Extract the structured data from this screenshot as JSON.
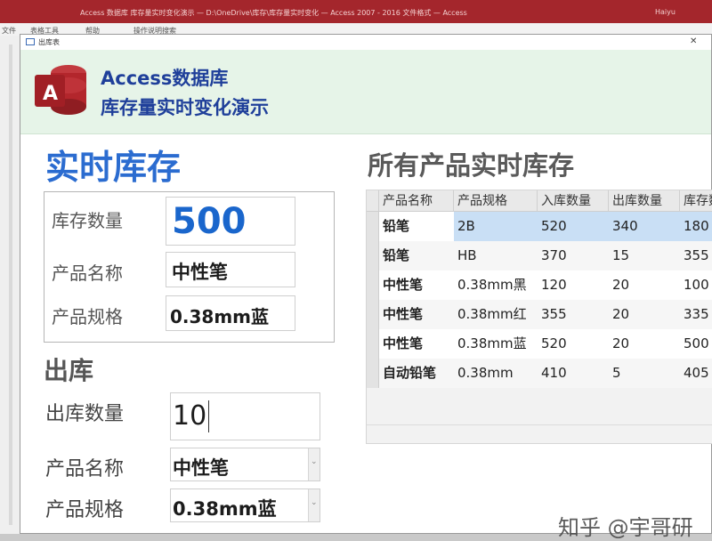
{
  "app": {
    "titlebar_text": "Access 数据库 库存量实时变化演示 — D:\\OneDrive\\库存\\库存量实时变化 — Access 2007 - 2016 文件格式 — Access",
    "user_text": "Haiyu"
  },
  "ribbon": {
    "items": [
      "文件",
      "表格工具",
      "帮助",
      "操作说明搜索"
    ]
  },
  "form": {
    "tab_label": "出库表",
    "header": {
      "line1": "Access数据库",
      "line2": "库存量实时变化演示",
      "logo_letter": "A"
    },
    "stock": {
      "title": "实时库存",
      "qty_label": "库存数量",
      "qty_value": "500",
      "name_label": "产品名称",
      "name_value": "中性笔",
      "spec_label": "产品规格",
      "spec_value": "0.38mm蓝"
    },
    "outbound": {
      "title": "出库",
      "qty_label": "出库数量",
      "qty_value": "10",
      "name_label": "产品名称",
      "name_value": "中性笔",
      "spec_label": "产品规格",
      "spec_value": "0.38mm蓝"
    },
    "all_products": {
      "title": "所有产品实时库存",
      "columns": [
        "产品名称",
        "产品规格",
        "入库数量",
        "出库数量",
        "库存数量"
      ],
      "rows": [
        [
          "铅笔",
          "2B",
          "520",
          "340",
          "180"
        ],
        [
          "铅笔",
          "HB",
          "370",
          "15",
          "355"
        ],
        [
          "中性笔",
          "0.38mm黑",
          "120",
          "20",
          "100"
        ],
        [
          "中性笔",
          "0.38mm红",
          "355",
          "20",
          "335"
        ],
        [
          "中性笔",
          "0.38mm蓝",
          "520",
          "20",
          "500"
        ],
        [
          "自动铅笔",
          "0.38mm",
          "410",
          "5",
          "405"
        ]
      ]
    }
  },
  "watermark": "知乎 @宇哥研",
  "colors": {
    "header_bg": "#e6f4e8",
    "header_text": "#1f3f9a",
    "title_blue": "#2b6cd0",
    "access_red": "#a4262c",
    "selected_row": "#c9dff5"
  }
}
